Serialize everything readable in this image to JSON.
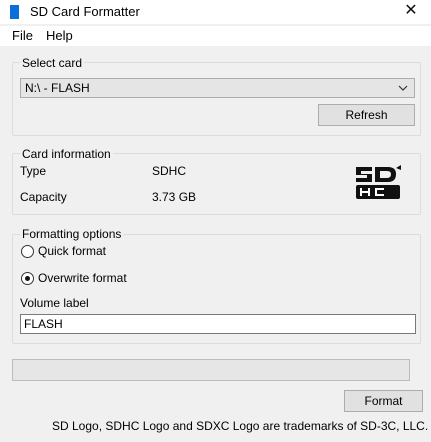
{
  "window": {
    "title": "SD Card Formatter",
    "close_glyph": "✕"
  },
  "menu": [
    "File",
    "Help"
  ],
  "select_card": {
    "label": "Select card",
    "selected": "N:\\ - FLASH",
    "refresh_label": "Refresh"
  },
  "card_info": {
    "label": "Card information",
    "rows": [
      {
        "key": "Type",
        "value": "SDHC"
      },
      {
        "key": "Capacity",
        "value": "3.73 GB"
      }
    ],
    "logo_icon": "sdhc-logo"
  },
  "formatting": {
    "label": "Formatting options",
    "options": [
      {
        "label": "Quick format",
        "checked": false
      },
      {
        "label": "Overwrite format",
        "checked": true
      }
    ],
    "volume_label": "Volume label",
    "volume_value": "FLASH"
  },
  "progress": {
    "value": 0
  },
  "format_button": "Format",
  "footer": "SD Logo, SDHC Logo and SDXC Logo are trademarks of SD-3C, LLC."
}
